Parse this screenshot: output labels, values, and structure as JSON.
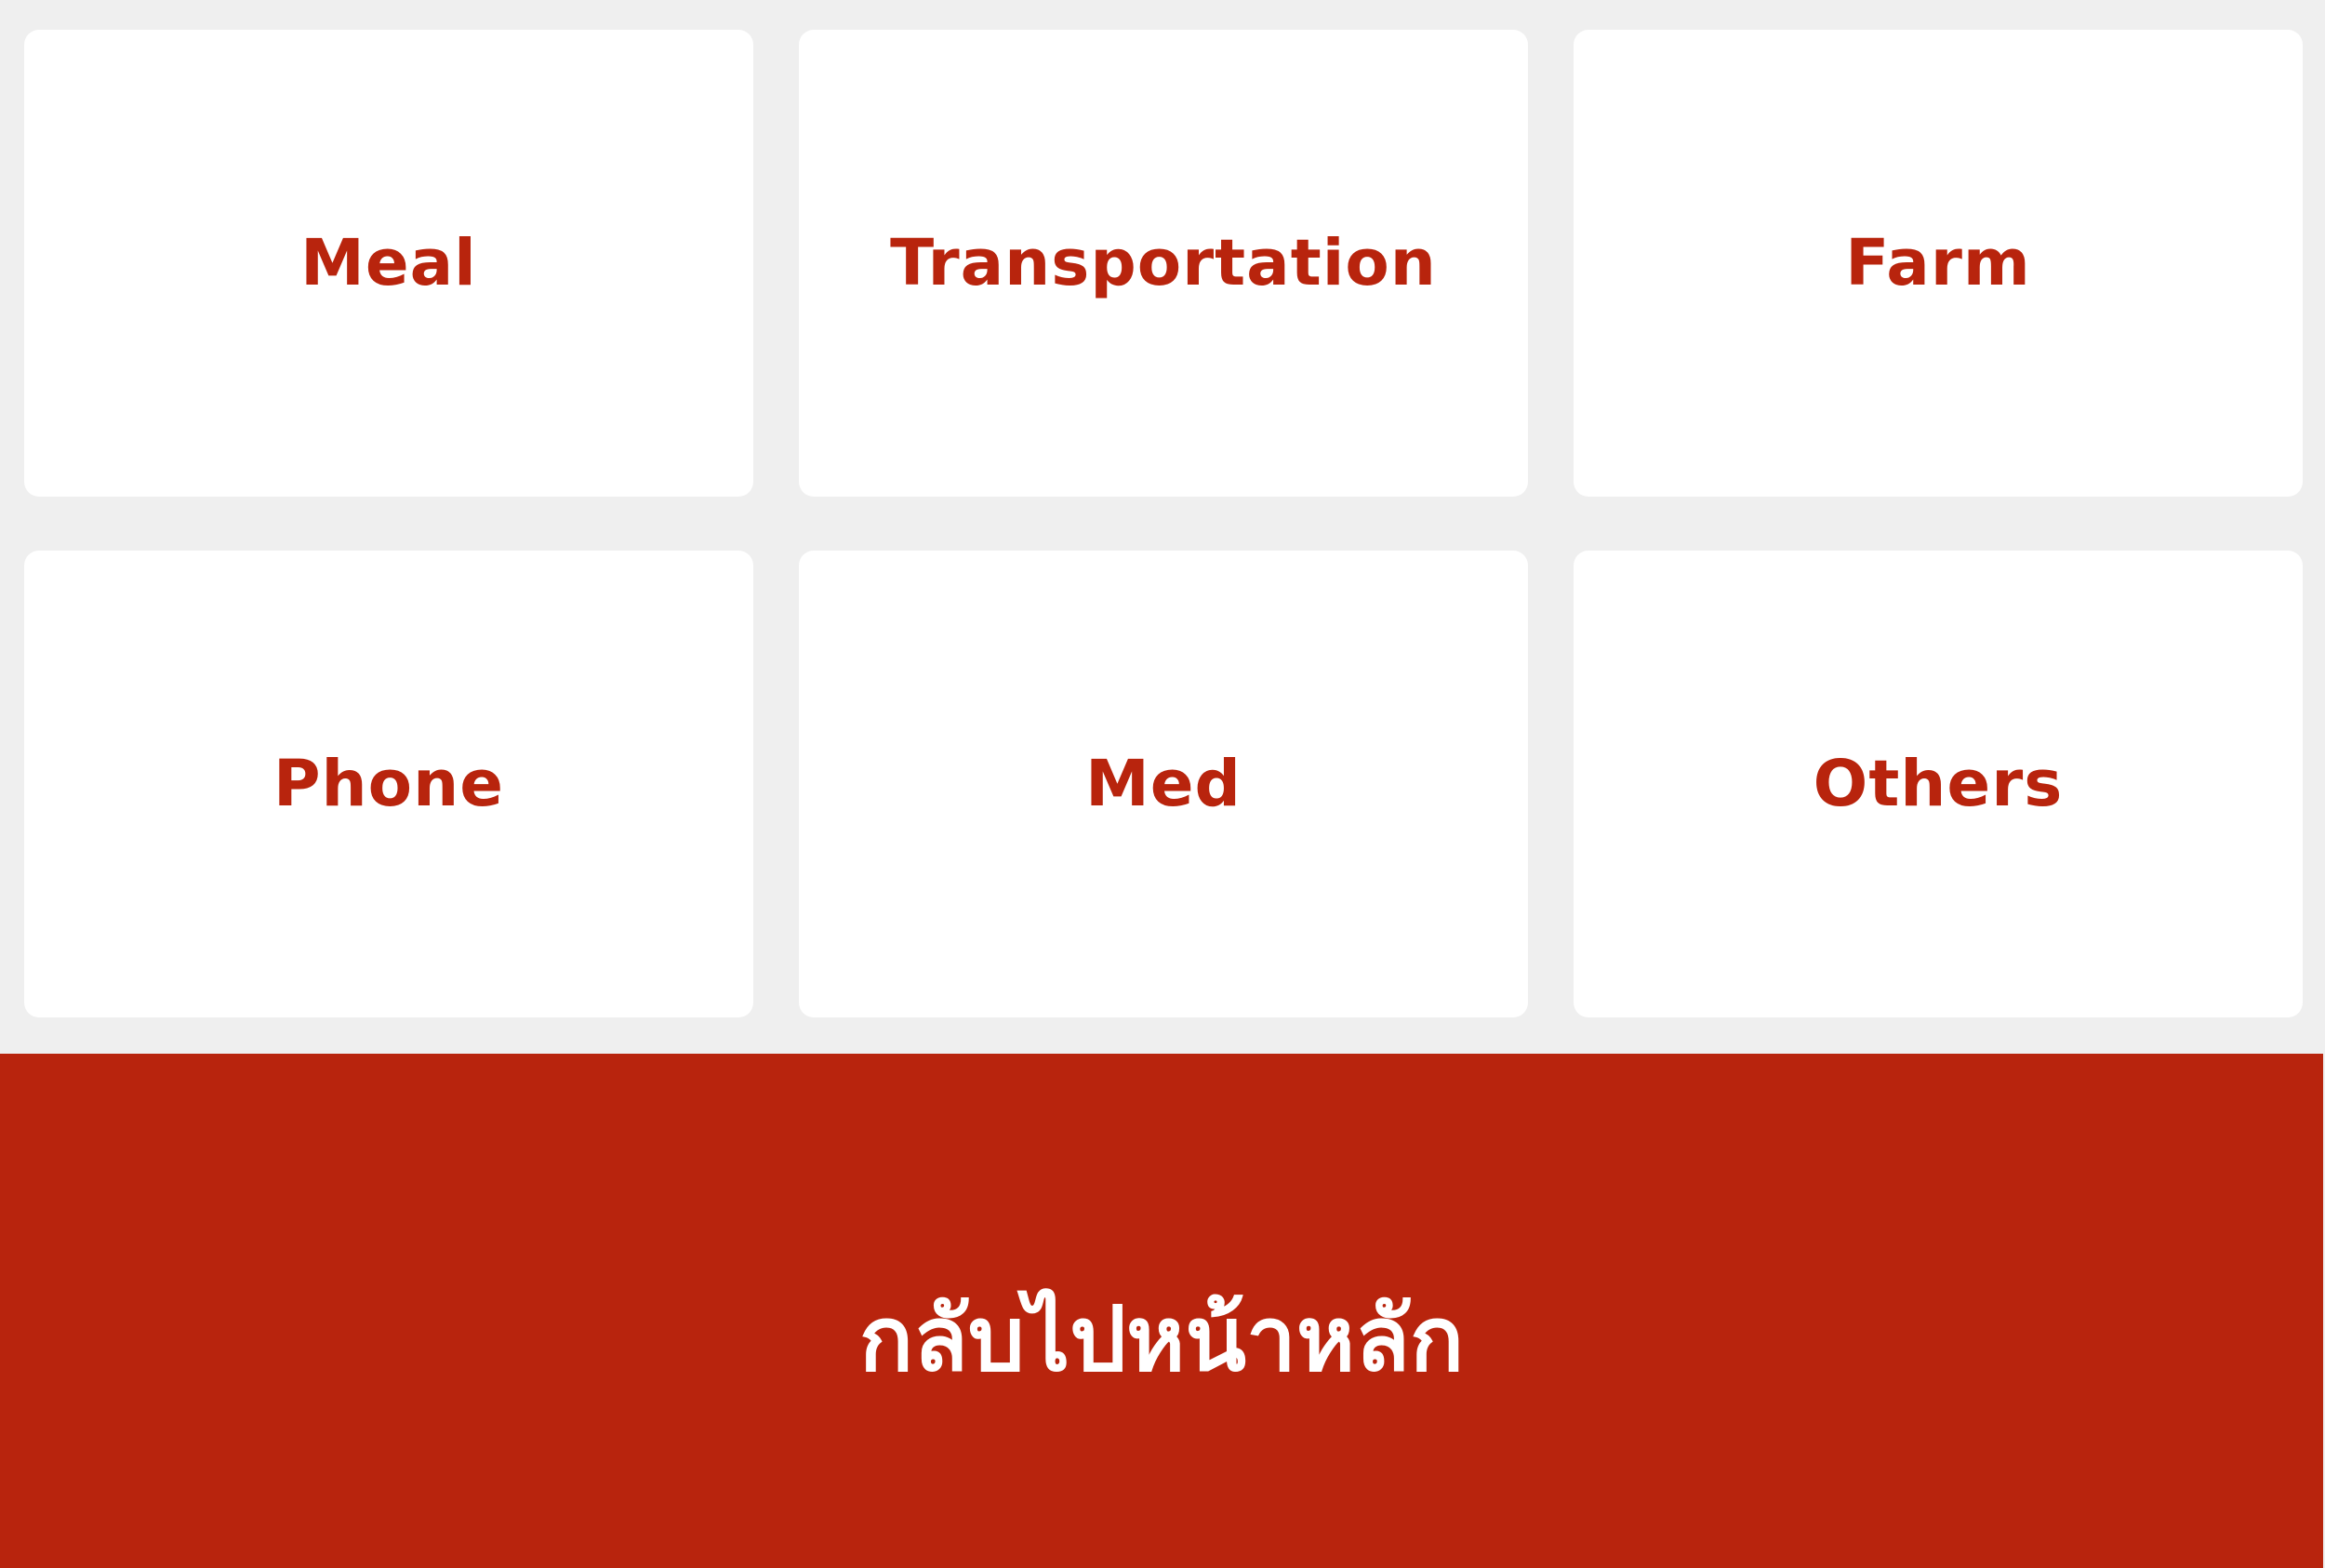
{
  "categories": [
    {
      "label": "Meal"
    },
    {
      "label": "Transportation"
    },
    {
      "label": "Farm"
    },
    {
      "label": "Phone"
    },
    {
      "label": "Med"
    },
    {
      "label": "Others"
    }
  ],
  "footer": {
    "back_label": "กลับไปหน้าหลัก"
  },
  "colors": {
    "accent": "#b8240d",
    "background": "#efefef",
    "tile": "#ffffff"
  }
}
